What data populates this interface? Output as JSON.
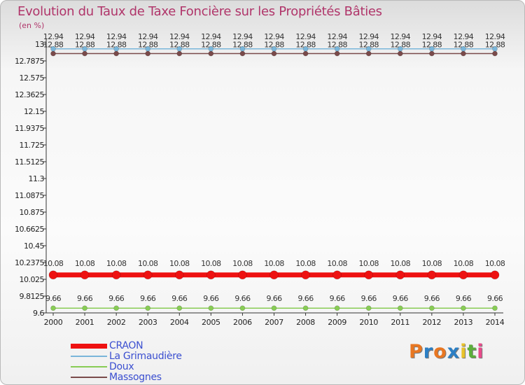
{
  "page": {
    "title": "Evolution du Taux de Taxe Foncière sur les Propriétés Bâties",
    "unit": "(en %)"
  },
  "chart_data": {
    "type": "line",
    "title": "Evolution du Taux de Taxe Foncière sur les Propriétés Bâties",
    "ylabel": "(en %)",
    "ylim": [
      9.6,
      13
    ],
    "yticks": [
      "9.6",
      "9.8125",
      "10.025",
      "10.2375",
      "10.45",
      "10.6625",
      "10.875",
      "11.0875",
      "11.3",
      "11.5125",
      "11.725",
      "11.9375",
      "12.15",
      "12.3625",
      "12.575",
      "12.7875",
      "13"
    ],
    "categories": [
      "2000",
      "2001",
      "2002",
      "2003",
      "2004",
      "2005",
      "2006",
      "2007",
      "2008",
      "2009",
      "2010",
      "2011",
      "2012",
      "2013",
      "2014"
    ],
    "series": [
      {
        "name": "CRAON",
        "color": "#ee1111",
        "values": [
          10.08,
          10.08,
          10.08,
          10.08,
          10.08,
          10.08,
          10.08,
          10.08,
          10.08,
          10.08,
          10.08,
          10.08,
          10.08,
          10.08,
          10.08
        ],
        "labels": [
          "10.08",
          "10.08",
          "10.08",
          "10.08",
          "10.08",
          "10.08",
          "10.08",
          "10.08",
          "10.08",
          "10.08",
          "10.08",
          "10.08",
          "10.08",
          "10.08",
          "10.08"
        ]
      },
      {
        "name": "La Grimaudière",
        "color": "#7ab6da",
        "values": [
          12.94,
          12.94,
          12.94,
          12.94,
          12.94,
          12.94,
          12.94,
          12.94,
          12.94,
          12.94,
          12.94,
          12.94,
          12.94,
          12.94,
          12.94
        ],
        "labels": [
          "12.94",
          "12.94",
          "12.94",
          "12.94",
          "12.94",
          "12.94",
          "12.94",
          "12.94",
          "12.94",
          "12.94",
          "12.94",
          "12.94",
          "12.94",
          "12.94",
          "12.94"
        ]
      },
      {
        "name": "Doux",
        "color": "#88cc55",
        "values": [
          9.66,
          9.66,
          9.66,
          9.66,
          9.66,
          9.66,
          9.66,
          9.66,
          9.66,
          9.66,
          9.66,
          9.66,
          9.66,
          9.66,
          9.66
        ],
        "labels": [
          "9.66",
          "9.66",
          "9.66",
          "9.66",
          "9.66",
          "9.66",
          "9.66",
          "9.66",
          "9.66",
          "9.66",
          "9.66",
          "9.66",
          "9.66",
          "9.66",
          "9.66"
        ]
      },
      {
        "name": "Massognes",
        "color": "#7a4a4a",
        "values": [
          12.88,
          12.88,
          12.88,
          12.88,
          12.88,
          12.88,
          12.88,
          12.88,
          12.88,
          12.88,
          12.88,
          12.88,
          12.88,
          12.88,
          12.88
        ],
        "labels": [
          "12.88",
          "12.88",
          "12.88",
          "12.88",
          "12.88",
          "12.88",
          "12.88",
          "12.88",
          "12.88",
          "12.88",
          "12.88",
          "12.88",
          "12.88",
          "12.88",
          "12.88"
        ]
      }
    ],
    "grid": false,
    "legend": "bottom-left"
  },
  "legend": {
    "items": [
      {
        "label": "CRAON",
        "color": "#ee1111"
      },
      {
        "label": "La Grimaudière",
        "color": "#7ab6da"
      },
      {
        "label": "Doux",
        "color": "#88cc55"
      },
      {
        "label": "Massognes",
        "color": "#7a4a4a"
      }
    ]
  },
  "logo": {
    "letters": [
      "P",
      "r",
      "o",
      "x",
      "i",
      "t",
      "i"
    ],
    "colors": [
      "#e87722",
      "#2c7fc4",
      "#e87722",
      "#2c7fc4",
      "#e8c22a",
      "#5cae3b",
      "#e84a8a"
    ]
  }
}
